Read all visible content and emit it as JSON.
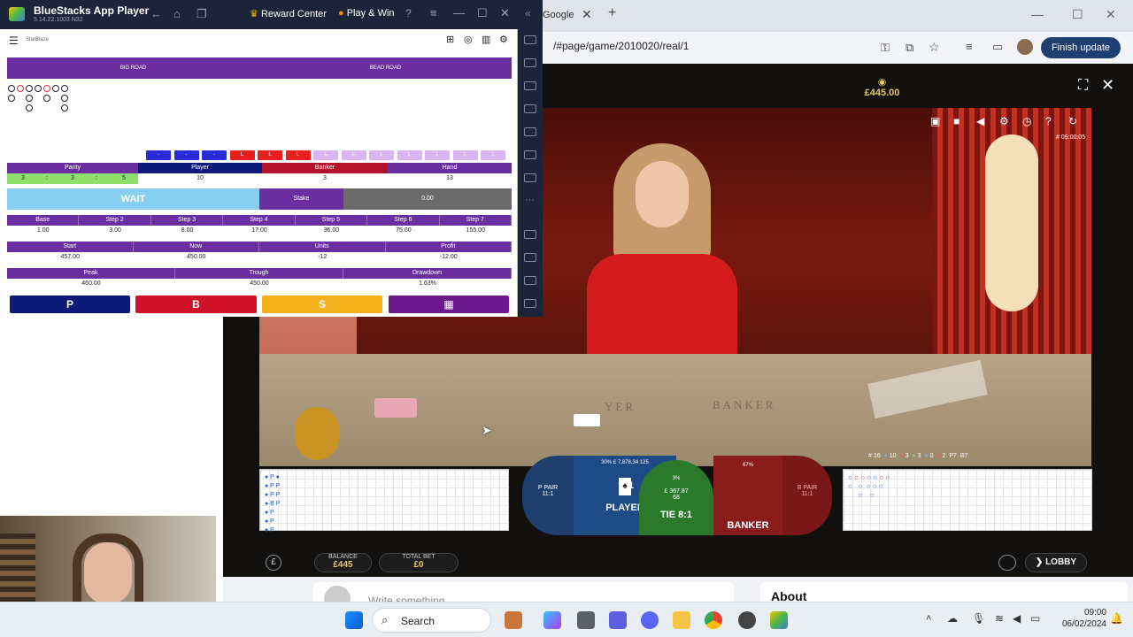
{
  "bluestacks": {
    "title": "BlueStacks App Player",
    "version": "5.14.22.1003 N32",
    "reward": "Reward Center",
    "play": "Play & Win"
  },
  "chrome": {
    "tab_label": "Google",
    "url": "/#page/game/2010020/real/1",
    "finish_update": "Finish update"
  },
  "app": {
    "brand": "StarBlaze",
    "big_road": "BIG ROAD",
    "bead_road": "BEAD ROAD",
    "stats_headers": [
      "Parity",
      "Player",
      "Banker",
      "Hand"
    ],
    "parity_values": [
      "3",
      ":",
      "3",
      ":",
      "5"
    ],
    "player": "10",
    "banker": "3",
    "hand": "13",
    "wait": "WAIT",
    "stake_label": "Stake",
    "stake_value": "0.00",
    "steps_headers": [
      "Base",
      "Step 2",
      "Step 3",
      "Step 4",
      "Step 5",
      "Step 6",
      "Step 7"
    ],
    "steps_values": [
      "1.00",
      "3.00",
      "8.00",
      "17.00",
      "36.00",
      "75.00",
      "155.00"
    ],
    "money_headers": [
      "Start",
      "Now",
      "Units",
      "Profit"
    ],
    "money_values": [
      "457.00",
      "450.00",
      "-12",
      "-12.00"
    ],
    "peak_headers": [
      "Peak",
      "Trough",
      "Drawdown"
    ],
    "peak_values": [
      "460.00",
      "450.00",
      "1.63%"
    ],
    "buttons": [
      "P",
      "B",
      "S"
    ],
    "seq_colors": [
      "#2b2bd6",
      "#2b2bd6",
      "#2b2bd6",
      "#e81f1f",
      "#e81f1f",
      "#e81f1f",
      "#d9b6f2",
      "#d9b6f2",
      "#d9b6f2",
      "#d9b6f2",
      "#d9b6f2",
      "#d9b6f2",
      "#d9b6f2"
    ],
    "seq_labels": [
      "-",
      "-",
      "-",
      "L",
      "L",
      "L",
      "L",
      "L",
      "L",
      "L",
      "L",
      "L",
      "L"
    ]
  },
  "game": {
    "balance_top": "£445.00",
    "round_id": "# 09:00:05",
    "table_labels": [
      "YER",
      "BANKER"
    ],
    "counts": [
      "16",
      "10",
      "3",
      "3",
      "0",
      "2"
    ],
    "p_pair": "P PAIR",
    "p_pair_odds": "11:1",
    "b_pair": "B PAIR",
    "b_pair_odds": "11:1",
    "player": "PLAYER",
    "tie": "TIE 8:1",
    "banker": "BANKER",
    "player_pct": "30%",
    "player_amt": "£ 7,878.34",
    "player_users": "125",
    "tie_pct": "3%",
    "tie_amt": "£ 367.87",
    "tie_users": "68",
    "banker_pct": "67%",
    "card_count": "1",
    "balance_label": "BALANCE",
    "balance_value": "£445",
    "total_bet_label": "TOTAL BET",
    "total_bet_value": "£0",
    "lobby": "LOBBY",
    "p7": "P7",
    "b7": "B7"
  },
  "bottom": {
    "about": "About",
    "write": "Write something"
  },
  "taskbar": {
    "search": "Search",
    "time": "09:00",
    "date": "06/02/2024"
  }
}
